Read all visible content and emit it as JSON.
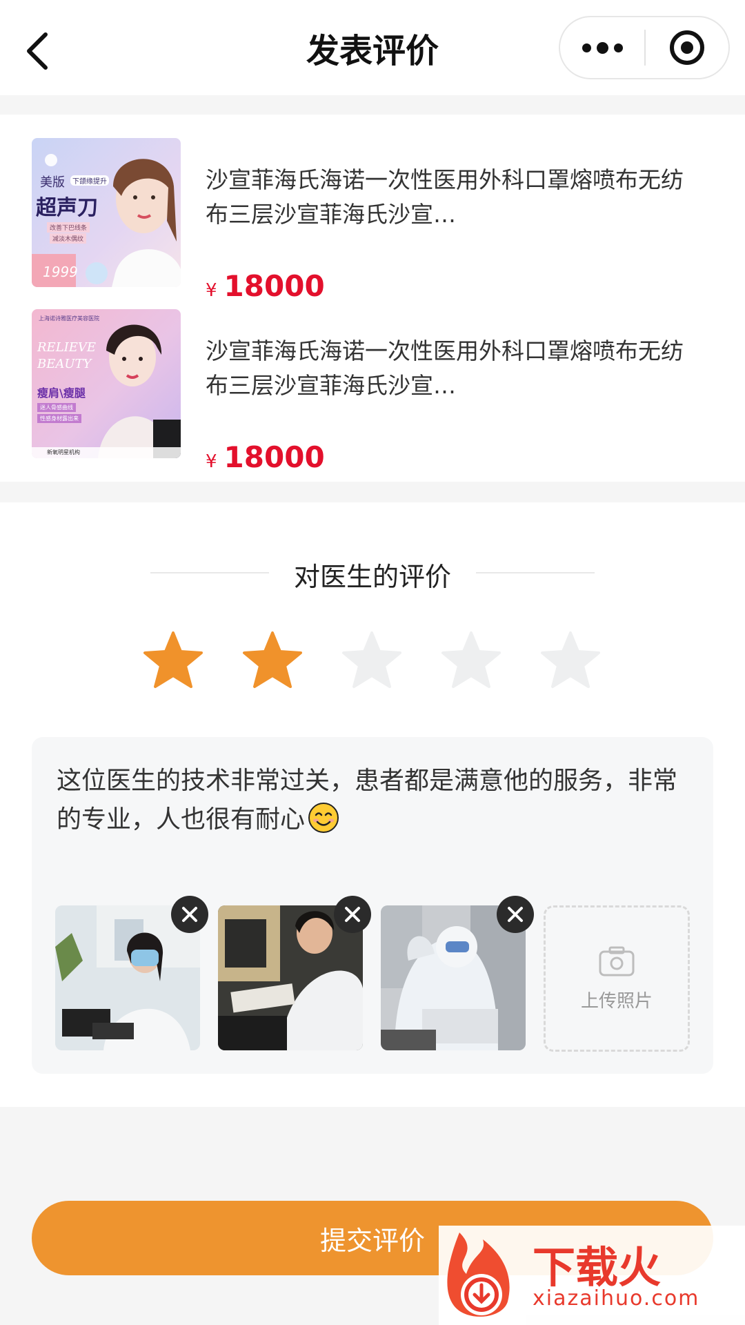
{
  "header": {
    "title": "发表评价"
  },
  "products": [
    {
      "name": "沙宣菲海氏海诺一次性医用外科口罩熔喷布无纺布三层沙宣菲海氏沙宣…",
      "currency": "¥",
      "price": "18000",
      "thumb_text_top": "美版",
      "thumb_text_tag": "下颌缘提升",
      "thumb_text_main": "超声刀",
      "thumb_text_line1": "改善下巴线条",
      "thumb_text_line2": "减淡木偶纹",
      "thumb_text_price": "1999"
    },
    {
      "name": "沙宣菲海氏海诺一次性医用外科口罩熔喷布无纺布三层沙宣菲海氏沙宣…",
      "currency": "¥",
      "price": "18000",
      "thumb_text_hospital": "上海诺诗雅医疗美容医院",
      "thumb_text_script": "RELIEVE BEAUTY",
      "thumb_text_main": "瘦肩\\瘦腿",
      "thumb_text_line1": "迷人骨感曲线",
      "thumb_text_line2": "性感身材露出来",
      "thumb_text_footer": "新氧明星机构"
    }
  ],
  "review": {
    "section_title": "对医生的评价",
    "rating": 2,
    "max_rating": 5,
    "star_active_color": "#f0922b",
    "star_inactive_color": "#eeeff0",
    "comment": "这位医生的技术非常过关，患者都是满意他的服务，非常的专业，人也很有耐心",
    "emoji": "smiling-face-icon",
    "photos": [
      "photo-doctor-computer",
      "photo-doctor-desk",
      "photo-protective-suit"
    ],
    "upload_label": "上传照片"
  },
  "footer": {
    "submit_label": "提交评价",
    "accent_color": "#ee942f"
  },
  "watermark": {
    "brand": "下载火",
    "domain": "xiazaihuo.com"
  }
}
